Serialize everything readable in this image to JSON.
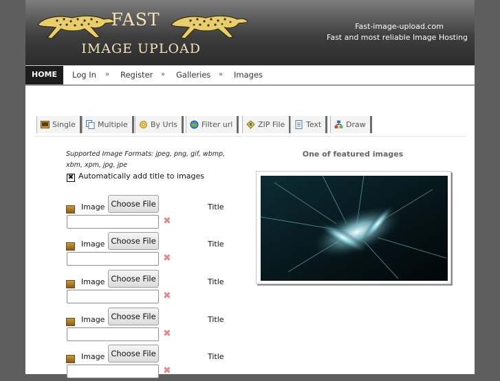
{
  "header": {
    "logo_word_1": "FAST",
    "logo_word_2": "IMAGE UPLOAD",
    "logo_icon": "cheetah-icon",
    "site_domain": "Fast-image-upload.com",
    "site_tagline": "Fast and most reliable Image Hosting"
  },
  "nav": {
    "home": "HOME",
    "items": [
      "Log In",
      "Register",
      "Galleries",
      "Images"
    ],
    "separator": "»"
  },
  "tabs": [
    {
      "label": "Single",
      "icon": "single-image-icon"
    },
    {
      "label": "Multiple",
      "icon": "multiple-images-icon"
    },
    {
      "label": "By Urls",
      "icon": "urls-icon"
    },
    {
      "label": "Filter url",
      "icon": "filter-url-icon"
    },
    {
      "label": "ZIP File",
      "icon": "zip-icon"
    },
    {
      "label": "Text",
      "icon": "text-document-icon"
    },
    {
      "label": "Draw",
      "icon": "draw-icon"
    }
  ],
  "form": {
    "formats_text": "Supported Image Formats: jpeg, png, gif, wbmp, xbm, xpm, jpg, jpe",
    "auto_title_label": "Automatically add title to images",
    "auto_title_checked": true,
    "rows": [
      {
        "image_label": "Image",
        "button_label": "Choose File",
        "title_label": "Title",
        "title_value": ""
      },
      {
        "image_label": "Image",
        "button_label": "Choose File",
        "title_label": "Title",
        "title_value": ""
      },
      {
        "image_label": "Image",
        "button_label": "Choose File",
        "title_label": "Title",
        "title_value": ""
      },
      {
        "image_label": "Image",
        "button_label": "Choose File",
        "title_label": "Title",
        "title_value": ""
      },
      {
        "image_label": "Image",
        "button_label": "Choose File",
        "title_label": "Title",
        "title_value": ""
      }
    ]
  },
  "featured": {
    "title": "One of featured images"
  },
  "colors": {
    "page_bg": "#5e5e5e",
    "header_dark": "#2b2b2b",
    "logo_gold": "#f3e3b8",
    "delete_red": "#e38a8a"
  }
}
